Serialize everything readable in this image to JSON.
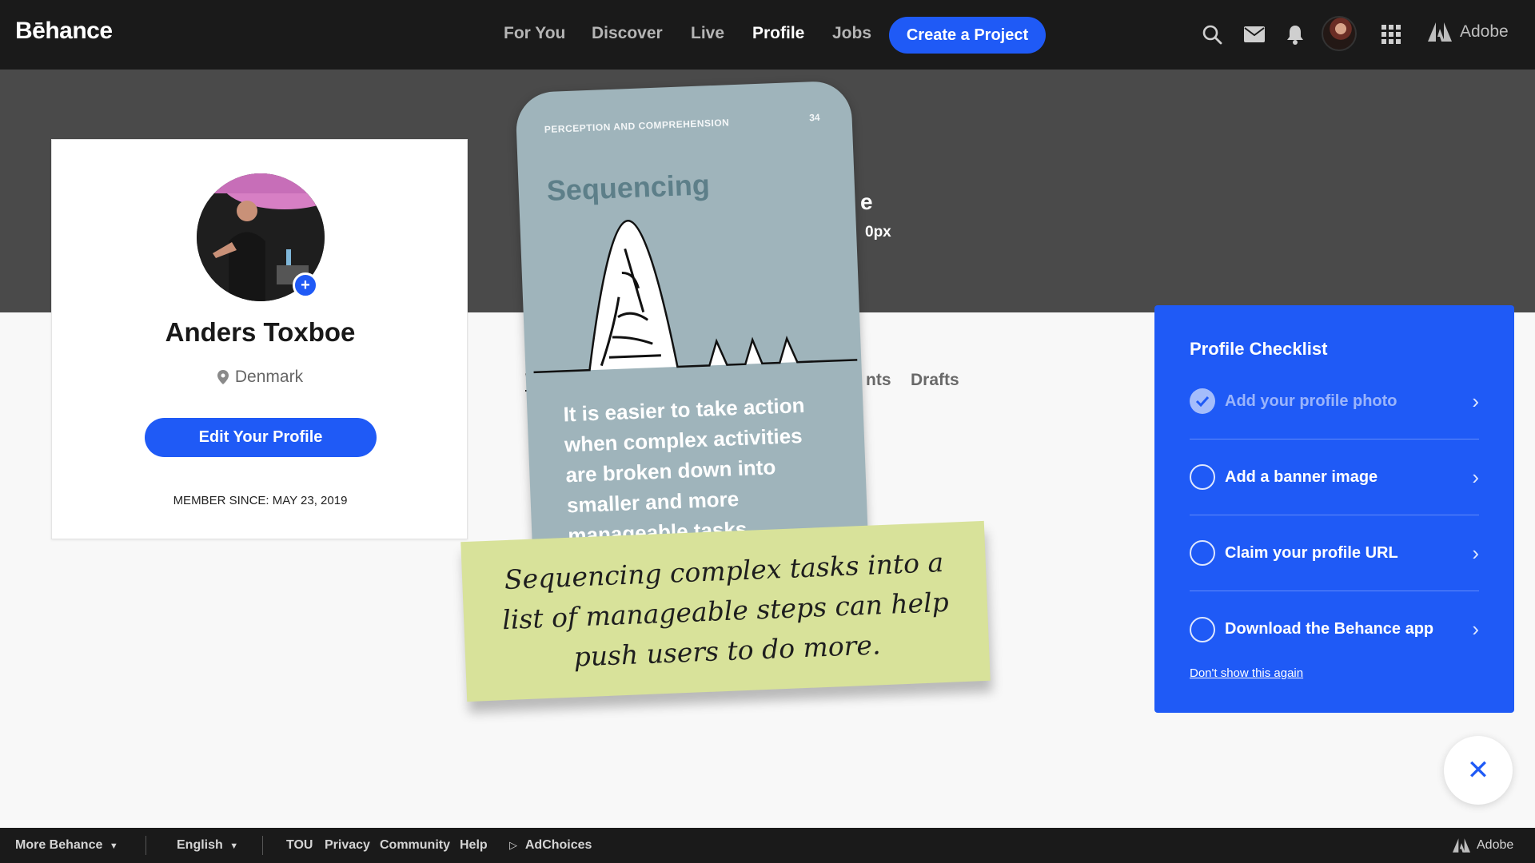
{
  "header": {
    "logo": "Bēhance",
    "nav": [
      "For You",
      "Discover",
      "Live",
      "Profile",
      "Jobs"
    ],
    "active_nav": "Profile",
    "cta": "Create a Project",
    "adobe": "Adobe"
  },
  "banner": {
    "hint_line1": "e",
    "hint_line2": "0px"
  },
  "profile": {
    "name": "Anders Toxboe",
    "location": "Denmark",
    "edit_button": "Edit Your Profile",
    "member_since": "MEMBER SINCE: MAY 23, 2019",
    "add_photo": "+"
  },
  "tabs": {
    "work": "W",
    "drafts_partial": "nts",
    "drafts": "Drafts"
  },
  "overlay_card": {
    "header": "PERCEPTION AND COMPREHENSION",
    "page_number": "34",
    "title": "Sequencing",
    "body": "It is easier to take action when complex activities are broken down into smaller and more manageable tasks"
  },
  "sticky_note": {
    "text": "Sequencing complex tasks into a list of manageable steps can help push users to do more."
  },
  "checklist": {
    "title": "Profile Checklist",
    "items": [
      {
        "label": "Add your profile photo",
        "done": true
      },
      {
        "label": "Add a banner image",
        "done": false
      },
      {
        "label": "Claim your profile URL",
        "done": false
      },
      {
        "label": "Download the Behance app",
        "done": false
      }
    ],
    "dismiss": "Don't show this again"
  },
  "fab": {
    "close": "✕"
  },
  "footer": {
    "more": "More Behance",
    "language": "English",
    "links": [
      "TOU",
      "Privacy",
      "Community",
      "Help"
    ],
    "adchoices": "AdChoices",
    "adobe": "Adobe"
  },
  "colors": {
    "brand_blue": "#1f5af6",
    "topbar": "#1a1a1a",
    "banner": "#4a4a4a",
    "sticky": "#d8e29a",
    "card": "#9fb4bb"
  }
}
